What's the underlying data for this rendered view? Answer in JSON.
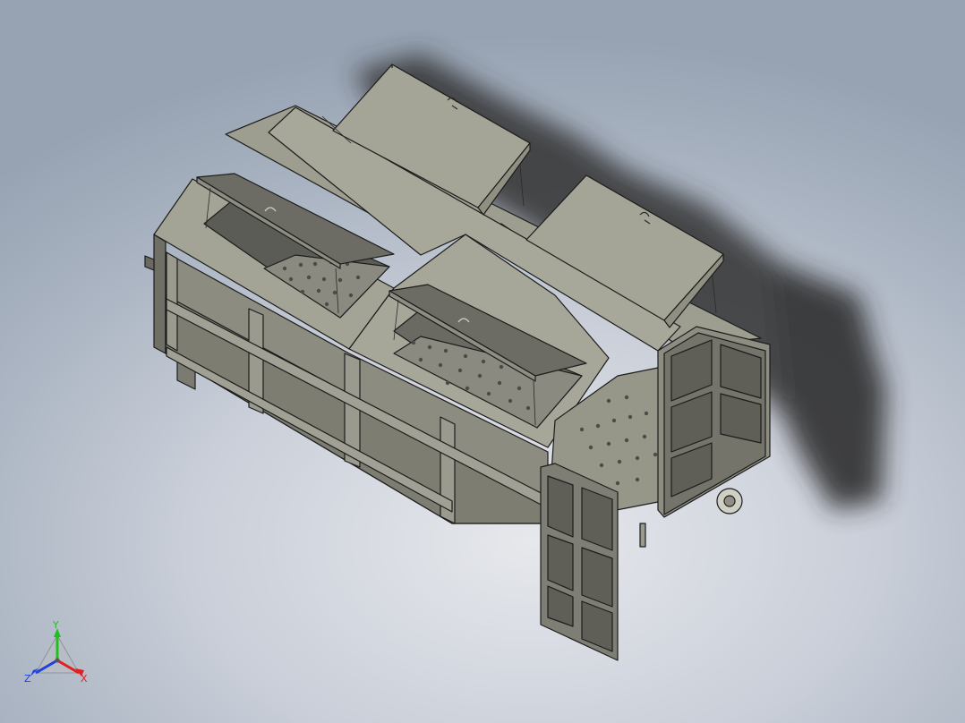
{
  "viewport": {
    "background_top": "#97a3b3",
    "background_bottom": "#e6e8ec",
    "model_fill": "#8f8f82",
    "model_dark": "#5d5d55",
    "model_light": "#b4b4a6",
    "edge_color": "#1c1c1c",
    "shadow_color": "#2e2e30"
  },
  "model": {
    "name_icon": "compression-waste-container",
    "lids": [
      "open-lid",
      "open-lid",
      "open-lid",
      "open-lid"
    ],
    "doors": [
      "rear-left-door",
      "rear-right-door"
    ]
  },
  "triad": {
    "x_label": "X",
    "y_label": "Y",
    "z_label": "Z",
    "x_color": "#e02020",
    "y_color": "#20c020",
    "z_color": "#2040e0"
  }
}
